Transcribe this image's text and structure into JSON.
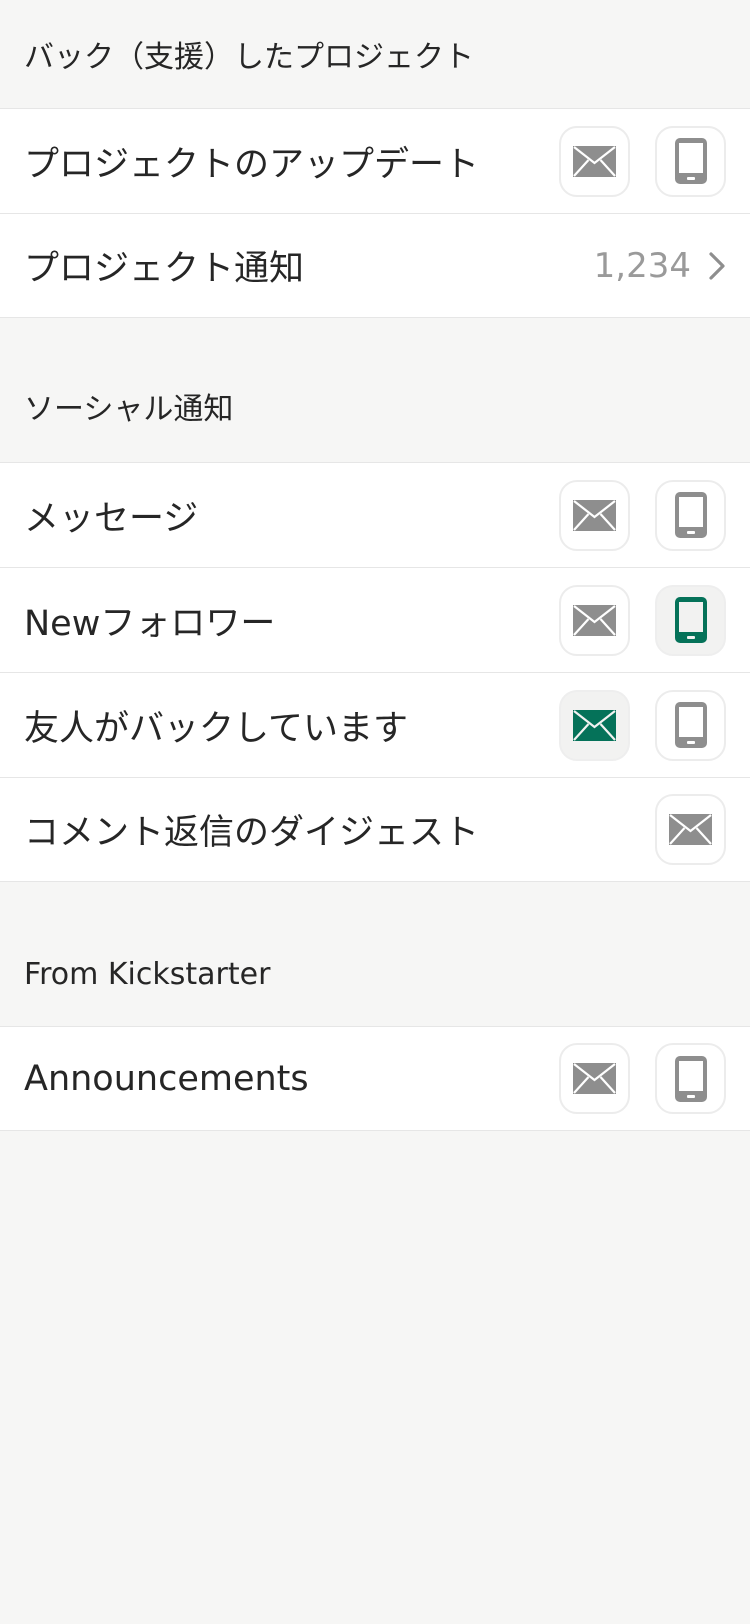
{
  "colors": {
    "background": "#f6f6f5",
    "row_background": "#ffffff",
    "icon_off": "#8e8e8e",
    "icon_on": "#057259",
    "count_text": "#9a9a9a"
  },
  "sections": {
    "backed": {
      "title": "バック（支援）したプロジェクト",
      "rows": {
        "updates": {
          "label": "プロジェクトのアップデート",
          "email": "off",
          "mobile": "off"
        },
        "notifications": {
          "label": "プロジェクト通知",
          "count": "1,234",
          "icon": "chevron-right-icon"
        }
      }
    },
    "social": {
      "title": "ソーシャル通知",
      "rows": {
        "messages": {
          "label": "メッセージ",
          "email": "off",
          "mobile": "off"
        },
        "followers": {
          "label": "Newフォロワー",
          "email": "off",
          "mobile": "on"
        },
        "friend_backs": {
          "label": "友人がバックしています",
          "email": "on",
          "mobile": "off"
        },
        "comment_digest": {
          "label": "コメント返信のダイジェスト",
          "email": "off"
        }
      }
    },
    "kickstarter": {
      "title": "From Kickstarter",
      "rows": {
        "announcements": {
          "label": "Announcements",
          "email": "off",
          "mobile": "off"
        }
      }
    }
  },
  "icons": {
    "email": "mail-icon",
    "mobile": "phone-icon"
  }
}
